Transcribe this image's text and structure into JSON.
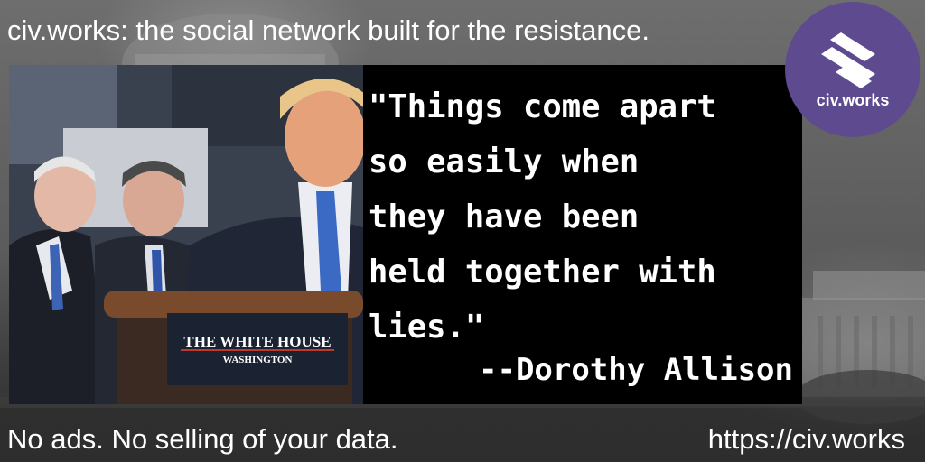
{
  "header": {
    "tagline": "civ.works: the social network built for the resistance."
  },
  "photo": {
    "podium_line1": "THE WHITE HOUSE",
    "podium_line2": "WASHINGTON"
  },
  "quote": {
    "lines": [
      "\"Things come apart",
      "so easily when",
      "they have been",
      "held together with",
      "lies.\""
    ],
    "attribution": "--Dorothy Allison"
  },
  "logo": {
    "text": "civ.works",
    "colors": {
      "circle": "#5e4a8f",
      "mark": "#ffffff"
    }
  },
  "footer": {
    "left": "No ads. No selling of your data.",
    "right": "https://civ.works"
  }
}
